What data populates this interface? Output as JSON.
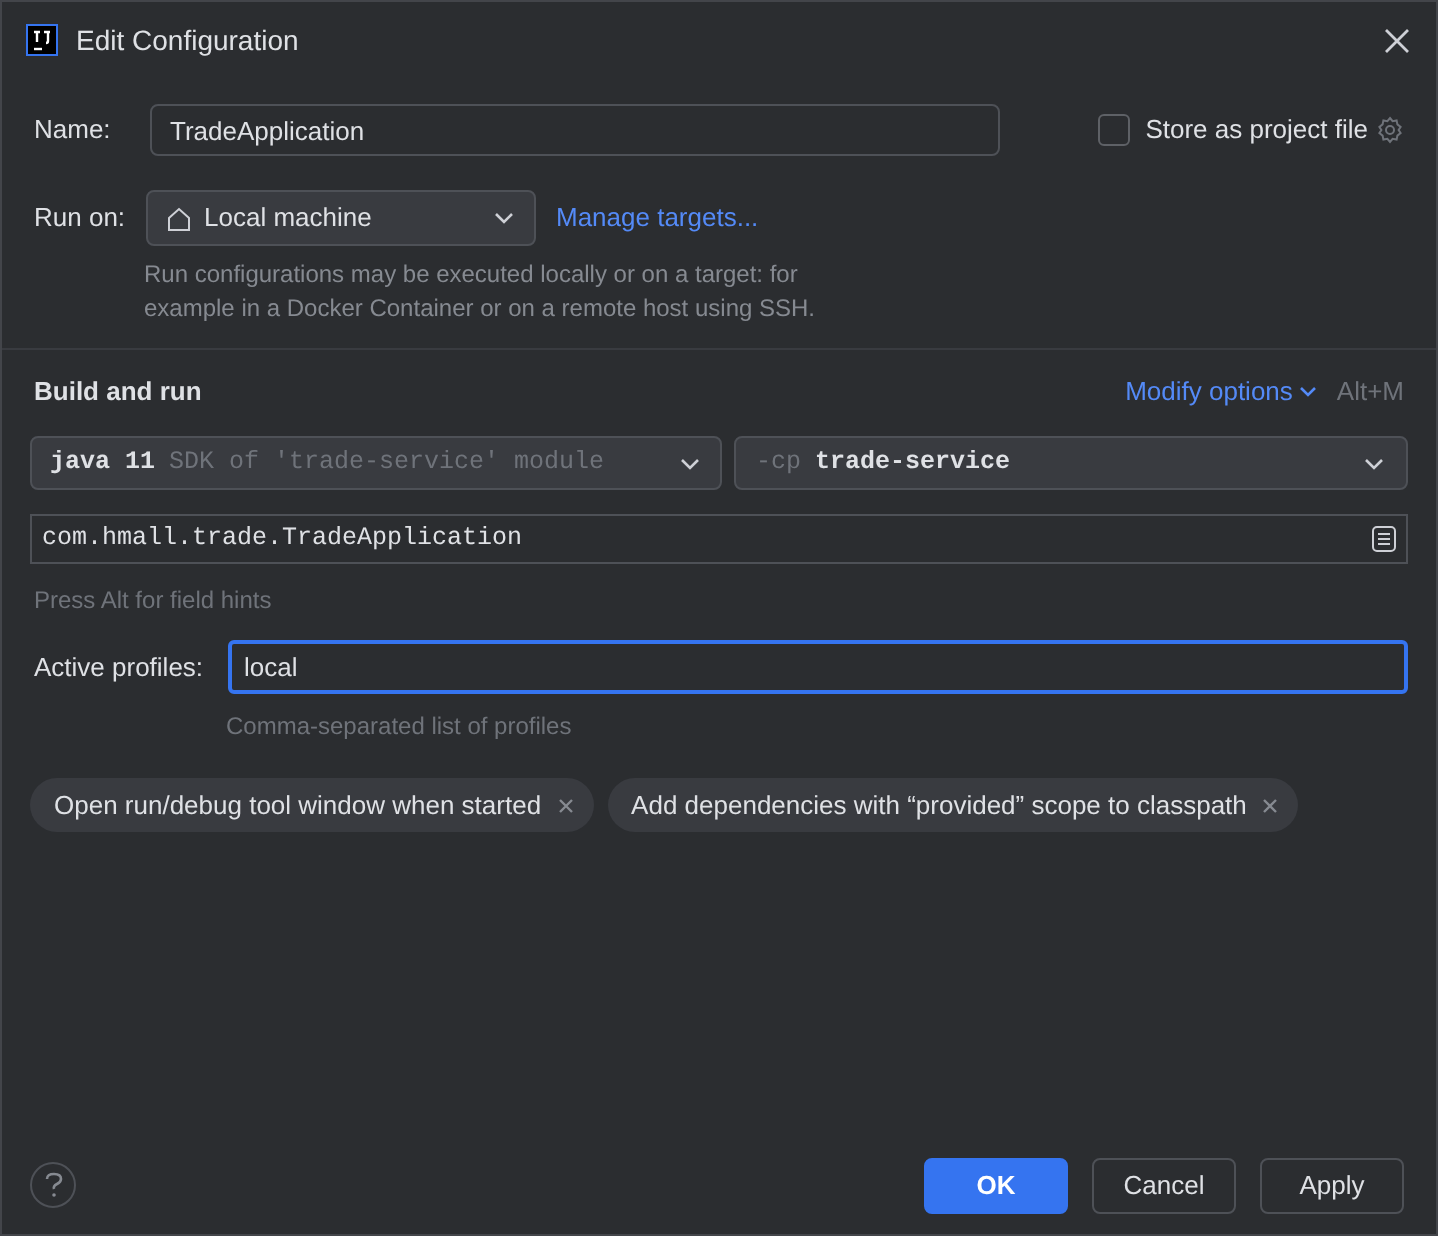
{
  "window": {
    "title": "Edit Configuration"
  },
  "name_field": {
    "label": "Name:",
    "value": "TradeApplication"
  },
  "store_as_project_file": {
    "label": "Store as project file",
    "checked": false
  },
  "run_on": {
    "label": "Run on:",
    "value": "Local machine",
    "link": "Manage targets...",
    "hint": "Run configurations may be executed locally or on a target: for example in a Docker Container or on a remote host using SSH."
  },
  "build_and_run": {
    "title": "Build and run",
    "modify_options": "Modify options",
    "shortcut": "Alt+M",
    "jdk": {
      "value": "java 11",
      "hint": "SDK of 'trade-service' module"
    },
    "classpath": {
      "flag": "-cp",
      "value": "trade-service"
    },
    "main_class": "com.hmall.trade.TradeApplication",
    "field_hints": "Press Alt for field hints"
  },
  "active_profiles": {
    "label": "Active profiles:",
    "value": "local",
    "focused": true,
    "hint": "Comma-separated list of profiles"
  },
  "options": [
    {
      "label": "Open run/debug tool window when started"
    },
    {
      "label": "Add dependencies with “provided” scope to classpath"
    }
  ],
  "buttons": [
    {
      "label": "OK",
      "kind": "primary"
    },
    {
      "label": "Cancel",
      "kind": "secondary"
    },
    {
      "label": "Apply",
      "kind": "secondary"
    }
  ]
}
